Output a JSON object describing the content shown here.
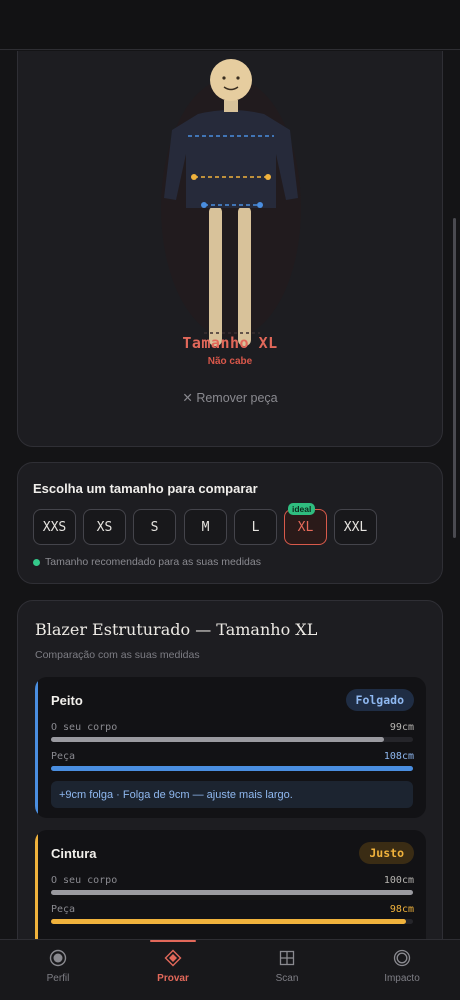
{
  "tryon": {
    "size_title": "Tamanho XL",
    "status": "Não cabe",
    "remove_label": "✕ Remover peça"
  },
  "size_picker": {
    "title": "Escolha um tamanho para comparar",
    "sizes": [
      "XXS",
      "XS",
      "S",
      "M",
      "L",
      "XL",
      "XXL"
    ],
    "selected": "XL",
    "ideal_badge": "ideal",
    "hint": "Tamanho recomendado para as suas medidas"
  },
  "comparison": {
    "title": "Blazer Estruturado — Tamanho XL",
    "subtitle": "Comparação com as suas medidas",
    "body_label": "O seu corpo",
    "garment_label": "Peça",
    "metrics": [
      {
        "name": "Peito",
        "badge": "Folgado",
        "body_value": "99cm",
        "garment_value": "108cm",
        "body_fill": 0.92,
        "garment_fill": 1.0,
        "note": "+9cm folga · Folga de 9cm — ajuste mais largo.",
        "accent": "#4a8ee0"
      },
      {
        "name": "Cintura",
        "badge": "Justo",
        "body_value": "100cm",
        "garment_value": "98cm",
        "body_fill": 1.0,
        "garment_fill": 0.98,
        "accent": "#f0b23c"
      }
    ]
  },
  "nav": {
    "items": [
      {
        "label": "Perfil",
        "icon": "profile-icon"
      },
      {
        "label": "Provar",
        "icon": "tryon-icon"
      },
      {
        "label": "Scan",
        "icon": "scan-icon"
      },
      {
        "label": "Impacto",
        "icon": "impact-icon"
      }
    ],
    "active": "Provar"
  },
  "colors": {
    "accent": "#e2685a",
    "ideal_green": "#2fbd7f",
    "loose_blue": "#4a8ee0",
    "tight_amber": "#f0b23c"
  }
}
